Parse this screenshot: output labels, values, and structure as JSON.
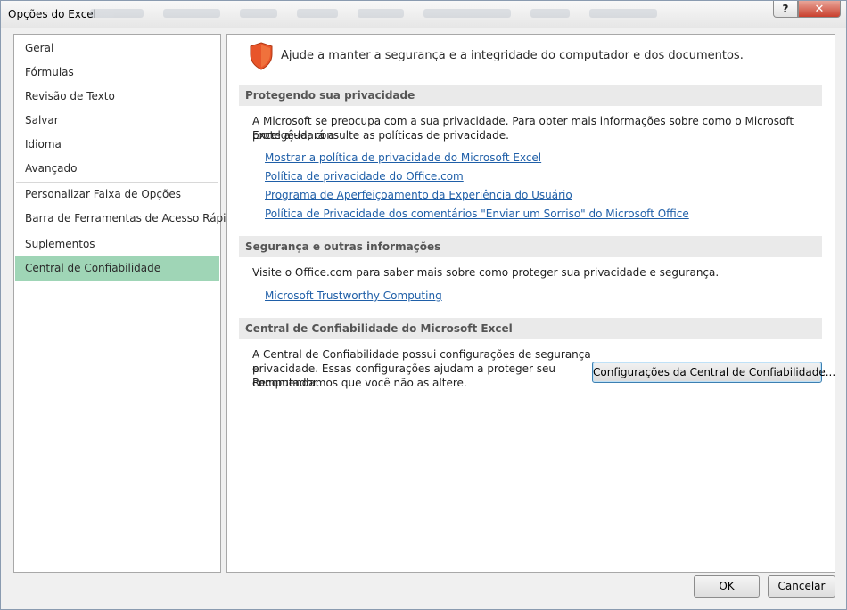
{
  "window": {
    "title": "Opções do Excel",
    "help_label": "?",
    "close_label": "✕"
  },
  "sidebar": {
    "items": [
      {
        "label": "Geral"
      },
      {
        "label": "Fórmulas"
      },
      {
        "label": "Revisão de Texto"
      },
      {
        "label": "Salvar"
      },
      {
        "label": "Idioma"
      },
      {
        "label": "Avançado"
      },
      {
        "label": "Personalizar Faixa de Opções"
      },
      {
        "label": "Barra de Ferramentas de Acesso Rápido"
      },
      {
        "label": "Suplementos"
      },
      {
        "label": "Central de Confiabilidade"
      }
    ],
    "selected": "Central de Confiabilidade",
    "selected_color": "#9fd5b6"
  },
  "content": {
    "header": "Ajude a manter a segurança e a integridade do computador e dos documentos.",
    "header_icon": "shield-icon",
    "sections": [
      {
        "title": "Protegendo sua privacidade",
        "text_lines": [
          "A Microsoft se preocupa com a sua privacidade. Para obter mais informações sobre como o Microsoft Excel ajudará a",
          "protegê-la, consulte as políticas de privacidade."
        ],
        "links": [
          "Mostrar a política de privacidade do Microsoft Excel",
          "Política de privacidade do Office.com",
          "Programa de Aperfeiçoamento da Experiência do Usuário",
          "Política de Privacidade dos comentários \"Enviar um Sorriso\" do Microsoft Office"
        ]
      },
      {
        "title": "Segurança e outras informações",
        "text": "Visite o Office.com para saber mais sobre como proteger sua privacidade e segurança.",
        "links": [
          "Microsoft Trustworthy Computing"
        ]
      },
      {
        "title": "Central de Confiabilidade do Microsoft Excel",
        "text_lines": [
          "A Central de Confiabilidade possui configurações de segurança e",
          "privacidade. Essas configurações ajudam a proteger seu computador.",
          "Recomendamos que você não as altere."
        ],
        "button_label": "Configurações da Central de Confiabilidade..."
      }
    ]
  },
  "footer": {
    "ok_label": "OK",
    "cancel_label": "Cancelar"
  },
  "colors": {
    "link": "#1f5fa8",
    "section_header_bg": "#eaeaea",
    "shield": "#e8552a"
  }
}
